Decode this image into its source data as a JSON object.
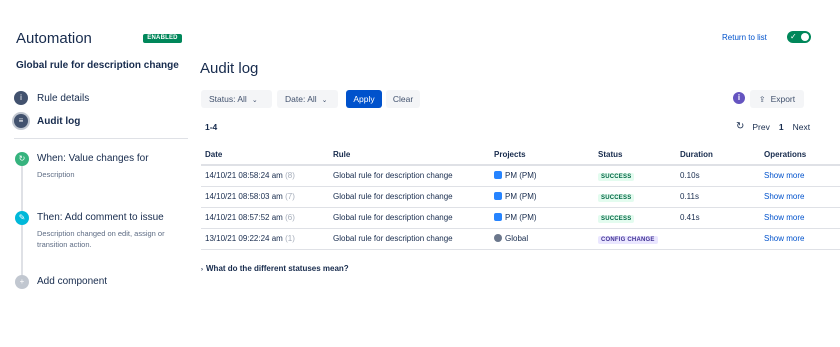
{
  "header": {
    "app_title": "Automation",
    "status_badge": "ENABLED",
    "return_link": "Return to list",
    "toggle_on": true
  },
  "sidebar": {
    "rule_name": "Global rule for description change",
    "nav": [
      {
        "label": "Rule details",
        "icon": "info-icon"
      },
      {
        "label": "Audit log",
        "icon": "list-icon",
        "active": true
      }
    ],
    "steps": [
      {
        "title": "When: Value changes for",
        "desc": "Description",
        "icon": "trigger-icon"
      },
      {
        "title": "Then: Add comment to issue",
        "desc": "Description changed on edit, assign or transition action.",
        "icon": "action-icon"
      },
      {
        "title": "Add component",
        "icon": "plus-icon"
      }
    ]
  },
  "main": {
    "title": "Audit log",
    "filters": {
      "status": "Status: All",
      "date": "Date: All",
      "apply": "Apply",
      "clear": "Clear"
    },
    "info_icon": "i",
    "export_label": "Export",
    "range": "1-4",
    "pager": {
      "prev": "Prev",
      "page": "1",
      "next": "Next"
    },
    "table": {
      "columns": [
        "Date",
        "Rule",
        "Projects",
        "Status",
        "Duration",
        "Operations"
      ],
      "rows": [
        {
          "date": "14/10/21 08:58:24 am",
          "id": "(8)",
          "rule": "Global rule for description change",
          "project": "PM (PM)",
          "project_icon": "project-icon",
          "status": "SUCCESS",
          "status_kind": "success",
          "duration": "0.10s",
          "op": "Show more"
        },
        {
          "date": "14/10/21 08:58:03 am",
          "id": "(7)",
          "rule": "Global rule for description change",
          "project": "PM (PM)",
          "project_icon": "project-icon",
          "status": "SUCCESS",
          "status_kind": "success",
          "duration": "0.11s",
          "op": "Show more"
        },
        {
          "date": "14/10/21 08:57:52 am",
          "id": "(6)",
          "rule": "Global rule for description change",
          "project": "PM (PM)",
          "project_icon": "project-icon",
          "status": "SUCCESS",
          "status_kind": "success",
          "duration": "0.41s",
          "op": "Show more"
        },
        {
          "date": "13/10/21 09:22:24 am",
          "id": "(1)",
          "rule": "Global rule for description change",
          "project": "Global",
          "project_icon": "globe-icon",
          "status": "CONFIG CHANGE",
          "status_kind": "config",
          "duration": "",
          "op": "Show more"
        }
      ]
    },
    "faq": "What do the different statuses mean?"
  },
  "colors": {
    "primary": "#0052cc",
    "enabled_green": "#00875a",
    "success_bg": "#e3fcef",
    "config_bg": "#eae6ff"
  }
}
